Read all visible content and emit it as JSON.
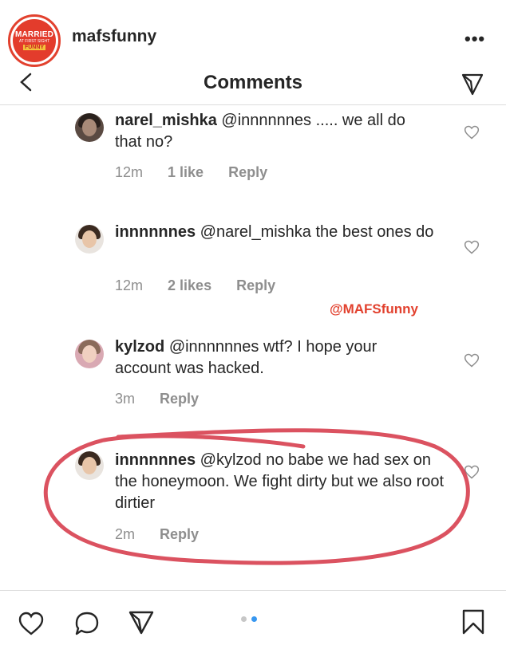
{
  "post": {
    "account_name": "mafsfunny",
    "logo_line1": "MARRIED",
    "logo_line2": "AT FIRST SIGHT",
    "logo_line3": "FUNNY",
    "more_icon": "more-horizontal-icon"
  },
  "header": {
    "title": "Comments",
    "back_icon": "chevron-left-icon",
    "send_icon": "send-icon"
  },
  "comments": [
    {
      "username": "narel_mishka",
      "mention": "@innnnnnes",
      "text": " ..... we all do that no?",
      "time": "12m",
      "likes": "1 like",
      "reply": "Reply"
    },
    {
      "username": "innnnnnes",
      "mention": "@narel_mishka",
      "text": " the best ones do",
      "time": "12m",
      "likes": "2 likes",
      "reply": "Reply"
    },
    {
      "username": "kylzod",
      "mention": "@innnnnnes",
      "text": " wtf? I hope your account was hacked.",
      "time": "3m",
      "likes": "",
      "reply": "Reply"
    },
    {
      "username": "innnnnnes",
      "mention": "@kylzod",
      "text": " no babe we had sex on the honeymoon. We fight dirty but we also root dirtier",
      "time": "2m",
      "likes": "",
      "reply": "Reply"
    }
  ],
  "watermark": "@MAFSfunny",
  "colors": {
    "annotation": "#d63a4a",
    "watermark": "#e2412e",
    "active_dot": "#3897f0"
  },
  "bottom_bar": {
    "icons": [
      "heart-icon",
      "comment-icon",
      "send-icon",
      "bookmark-icon"
    ],
    "carousel_page": 2,
    "carousel_total": 2
  }
}
